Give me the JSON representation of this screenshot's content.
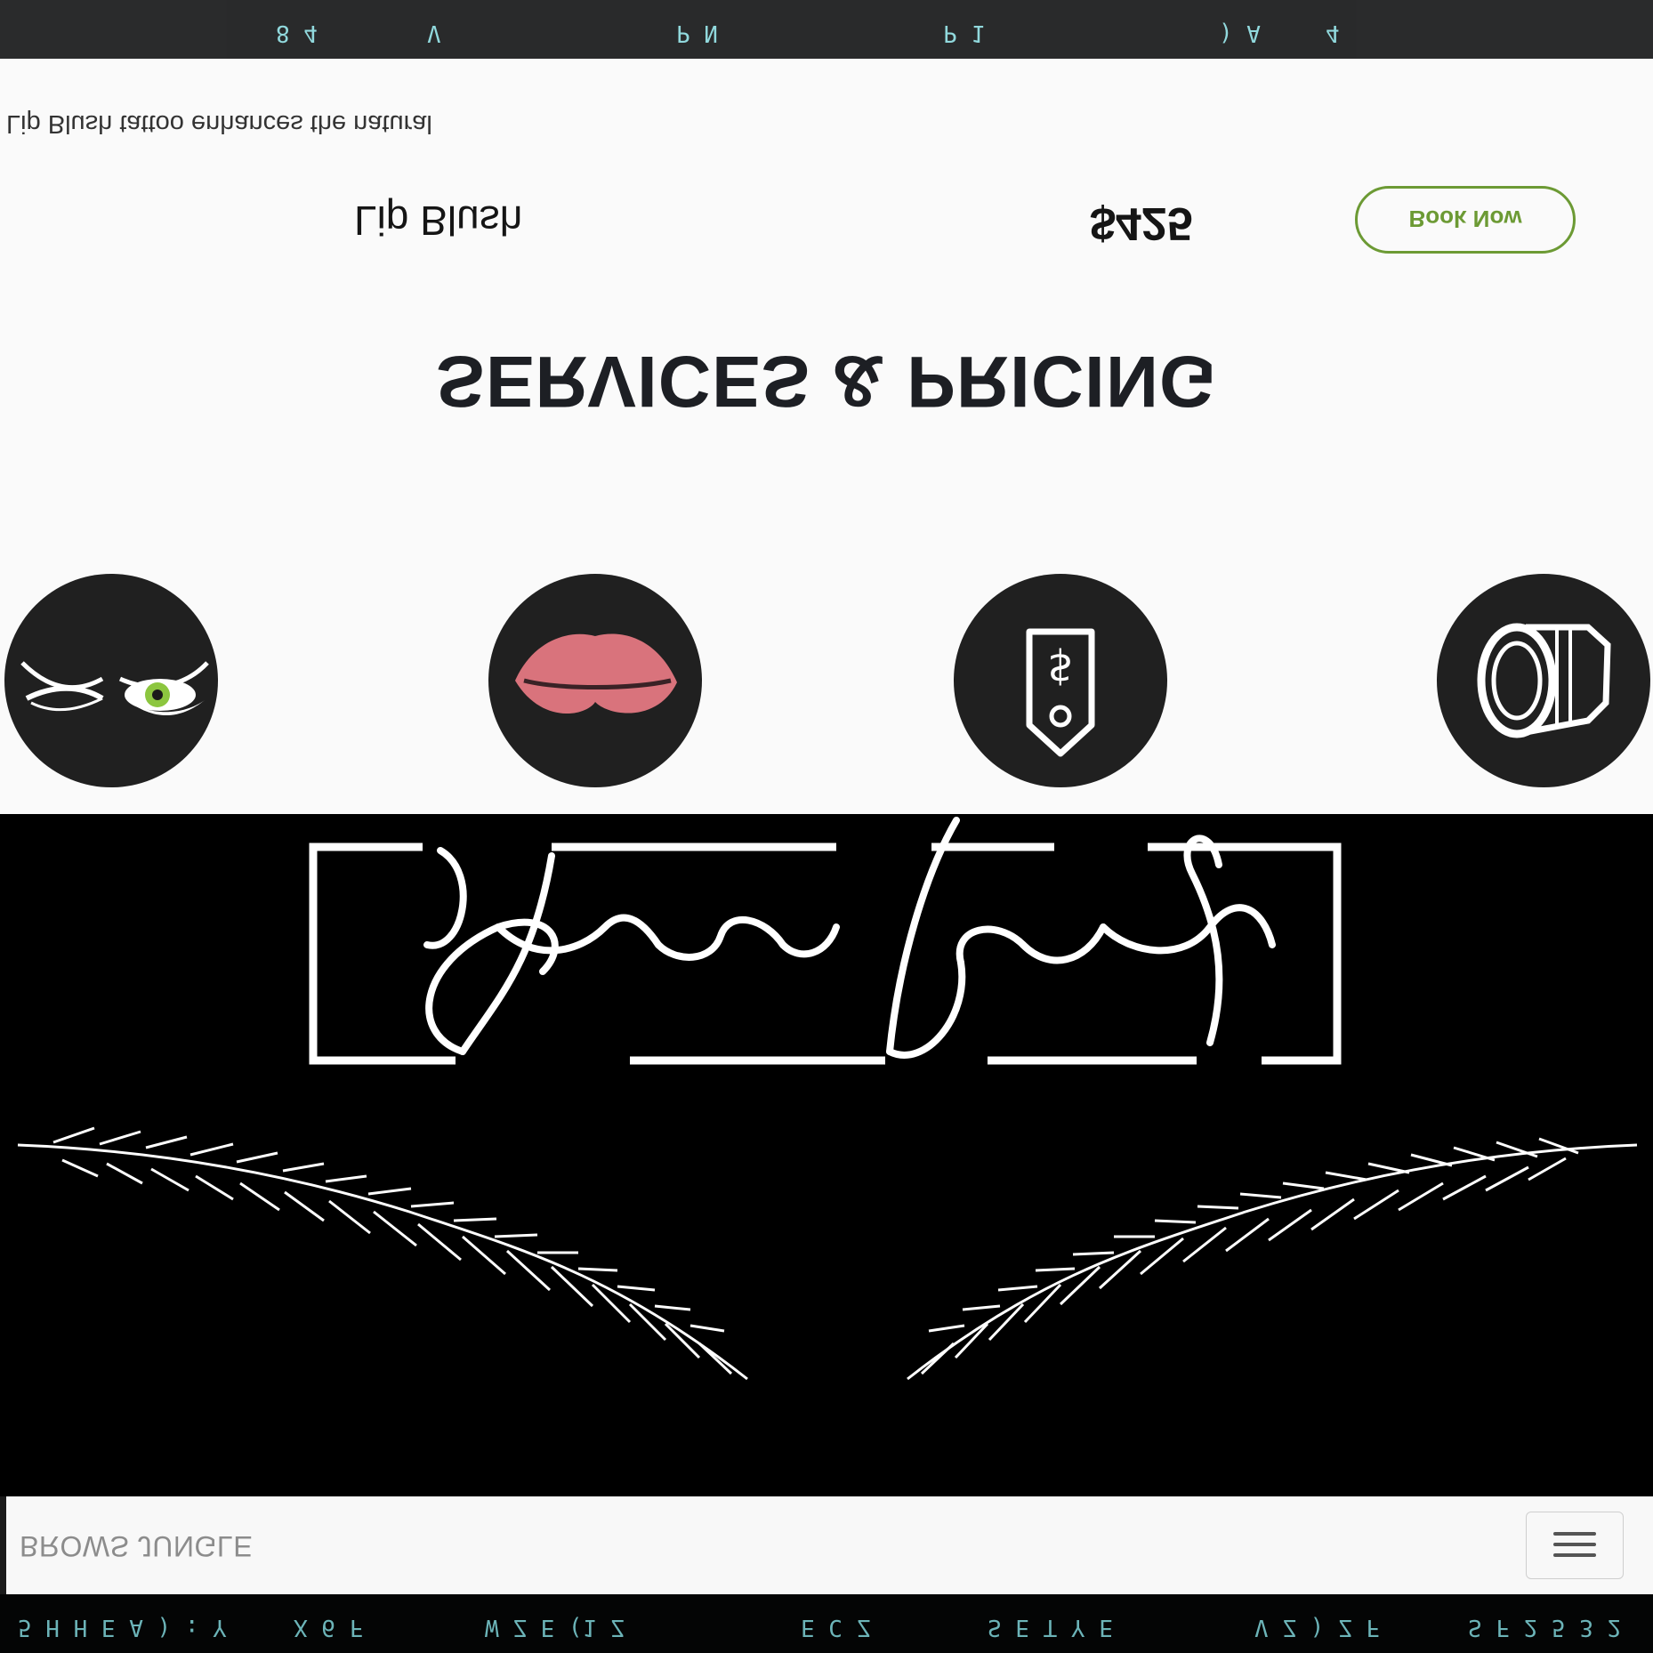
{
  "navbar": {
    "brand": "BROWS JUNGLE",
    "menu_icon": "hamburger-menu-icon"
  },
  "hero": {
    "logo_text": "Brows Jungle",
    "logo_image": "brows-jungle-logo"
  },
  "services": {
    "title": "SERVICES & PRICING",
    "icons": [
      "eyes-icon",
      "lips-icon",
      "price-tag-icon",
      "camera-icon"
    ],
    "item": {
      "name": "Lip Blush",
      "price": "$425",
      "book_label": "Book Now",
      "description": "Lip Blush tattoo enhances the natural"
    }
  },
  "colors": {
    "accent": "#6c9a34",
    "dark": "#1d1f24",
    "lip": "#d9737c",
    "eye_green": "#8cc63f"
  }
}
